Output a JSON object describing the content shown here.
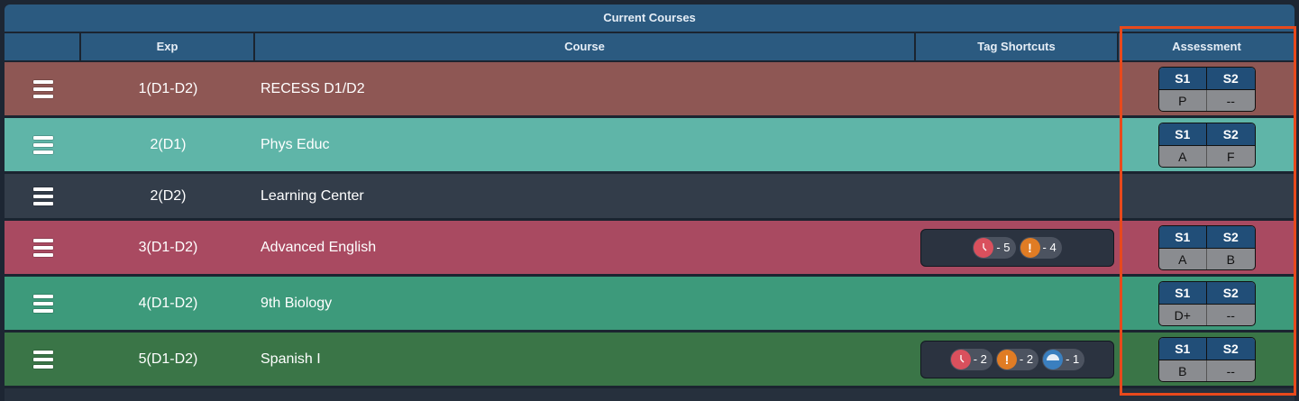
{
  "table": {
    "title": "Current Courses",
    "headers": {
      "exp": "Exp",
      "course": "Course",
      "tags": "Tag Shortcuts",
      "assessment": "Assessment"
    }
  },
  "assessment_labels": {
    "s1": "S1",
    "s2": "S2"
  },
  "rows": [
    {
      "exp": "1(D1-D2)",
      "course": "RECESS D1/D2",
      "color": "#8e5754",
      "grades": {
        "s1": "P",
        "s2": "--"
      }
    },
    {
      "exp": "2(D1)",
      "course": "Phys Educ",
      "color": "#5fb5a8",
      "grades": {
        "s1": "A",
        "s2": "F"
      }
    },
    {
      "exp": "2(D2)",
      "course": "Learning Center",
      "color": "#333d4a"
    },
    {
      "exp": "3(D1-D2)",
      "course": "Advanced English",
      "color": "#a94a61",
      "tags": [
        {
          "icon": "clock-icon",
          "label": "- 5",
          "color": "#d9505d"
        },
        {
          "icon": "exclamation-icon",
          "label": "- 4",
          "color": "#e07c24"
        }
      ],
      "grades": {
        "s1": "A",
        "s2": "B"
      }
    },
    {
      "exp": "4(D1-D2)",
      "course": "9th Biology",
      "color": "#3d9a7b",
      "grades": {
        "s1": "D+",
        "s2": "--"
      }
    },
    {
      "exp": "5(D1-D2)",
      "course": "Spanish I",
      "color": "#3a7547",
      "tags": [
        {
          "icon": "clock-icon",
          "label": "- 2",
          "color": "#d9505d"
        },
        {
          "icon": "exclamation-icon",
          "label": "- 2",
          "color": "#e07c24"
        },
        {
          "icon": "half-circle-icon",
          "label": "- 1",
          "color": "#3a7fbf"
        }
      ],
      "grades": {
        "s1": "B",
        "s2": "--"
      }
    }
  ],
  "colors": {
    "header": "#2b5a80",
    "highlight": "#e8491c"
  }
}
